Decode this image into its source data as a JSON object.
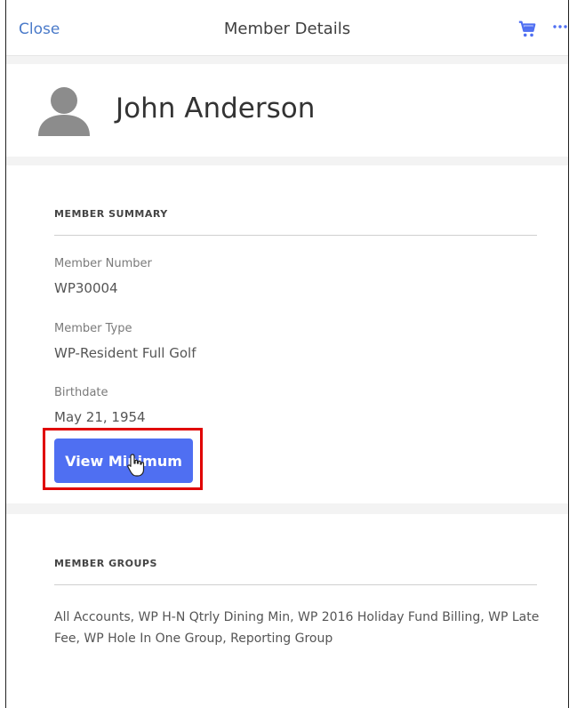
{
  "navbar": {
    "close_label": "Close",
    "title": "Member Details",
    "cart_icon": "shopping-cart-icon",
    "more_icon": "more-horizontal-icon"
  },
  "member": {
    "name": "John Anderson",
    "avatar_icon": "user-silhouette-icon"
  },
  "summary": {
    "title": "MEMBER SUMMARY",
    "fields": [
      {
        "label": "Member Number",
        "value": "WP30004"
      },
      {
        "label": "Member Type",
        "value": "WP-Resident Full Golf"
      },
      {
        "label": "Birthdate",
        "value": "May 21, 1954"
      }
    ],
    "button_label": "View Minimum"
  },
  "groups": {
    "title": "MEMBER GROUPS",
    "text": "All Accounts, WP H-N Qtrly Dining Min, WP 2016 Holiday Fund Billing, WP Late Fee, WP Hole In One Group, Reporting Group"
  },
  "colors": {
    "accent": "#4f6ff2",
    "link": "#4a7ac9",
    "highlight": "#e00000"
  }
}
